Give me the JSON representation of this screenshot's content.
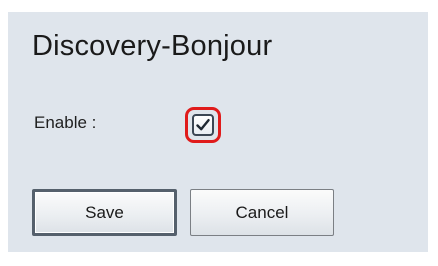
{
  "section": {
    "title": "Discovery-Bonjour"
  },
  "form": {
    "enable_label": "Enable :",
    "enable_checked": true
  },
  "buttons": {
    "save_label": "Save",
    "cancel_label": "Cancel"
  },
  "colors": {
    "panel_background": "#dfe5ec",
    "highlight": "#e01b1b"
  },
  "icons": {
    "checkbox": "checkmark-icon"
  }
}
